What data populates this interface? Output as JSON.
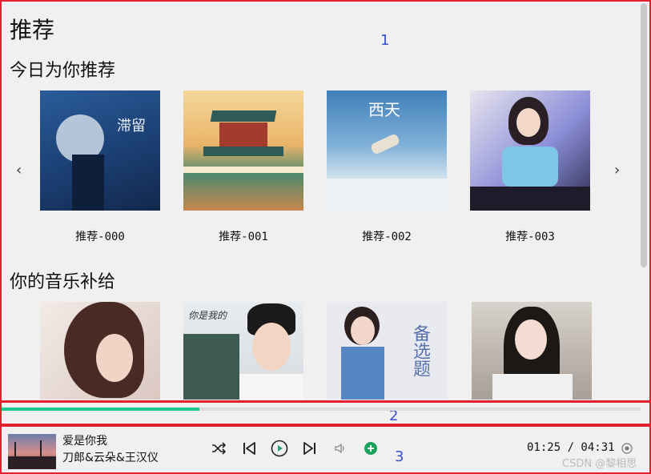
{
  "page": {
    "title": "推荐"
  },
  "sections": [
    {
      "title": "今日为你推荐",
      "items": [
        {
          "label": "推荐-000",
          "cover_text": "滞留"
        },
        {
          "label": "推荐-001"
        },
        {
          "label": "推荐-002",
          "cover_text": "西天"
        },
        {
          "label": "推荐-003"
        }
      ]
    },
    {
      "title": "你的音乐补给",
      "items": [
        {},
        {
          "cover_text": "你是我的"
        },
        {
          "cover_text": "备选题"
        },
        {}
      ]
    }
  ],
  "annotations": {
    "a1": "1",
    "a2": "2",
    "a3": "3"
  },
  "player": {
    "song_title": "爱是你我",
    "artist": "刀郎&云朵&王汉仪",
    "time": "01:25 / 04:31",
    "progress_fraction": 0.31
  },
  "carousel": {
    "prev_icon": "‹",
    "next_icon": "›"
  },
  "watermark": "CSDN @黎相思",
  "colors": {
    "accent": "#1ec88a",
    "frame": "#e5202e",
    "annotation": "#3b4fc9"
  }
}
